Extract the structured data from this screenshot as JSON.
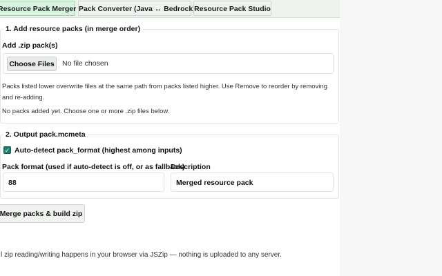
{
  "tabs": [
    {
      "label": "Resource Pack Merger",
      "active": true
    },
    {
      "label": "Pack Converter (Java ↔ Bedrock)",
      "active": false
    },
    {
      "label": "Resource Pack Studio",
      "active": false
    }
  ],
  "section1": {
    "legend": "1. Add resource packs (in merge order)",
    "zip_label": "Add .zip pack(s)",
    "choose_files_label": "Choose Files",
    "file_status": "No file chosen",
    "help_text": "Packs listed lower overwrite files at the same path from packs listed higher. Use Remove to reorder by removing and re-adding.",
    "empty_text": "No packs added yet. Choose one or more .zip files below."
  },
  "section2": {
    "legend": "2. Output pack.mcmeta",
    "auto_detect_label": "Auto-detect pack_format (highest among inputs)",
    "auto_detect_checked": true,
    "pack_format_label": "Pack format (used if auto-detect is off, or as fallback)",
    "pack_format_value": "88",
    "description_label": "Description",
    "description_value": "Merged resource pack"
  },
  "merge_button_label": "Merge packs & build zip",
  "footer_text": "l zip reading/writing happens in your browser via JSZip — nothing is uploaded to any server.",
  "colors": {
    "accent": "#1b7f6b",
    "active_tab": "#d7f4de"
  },
  "icons": {
    "checkbox": "check-icon"
  }
}
